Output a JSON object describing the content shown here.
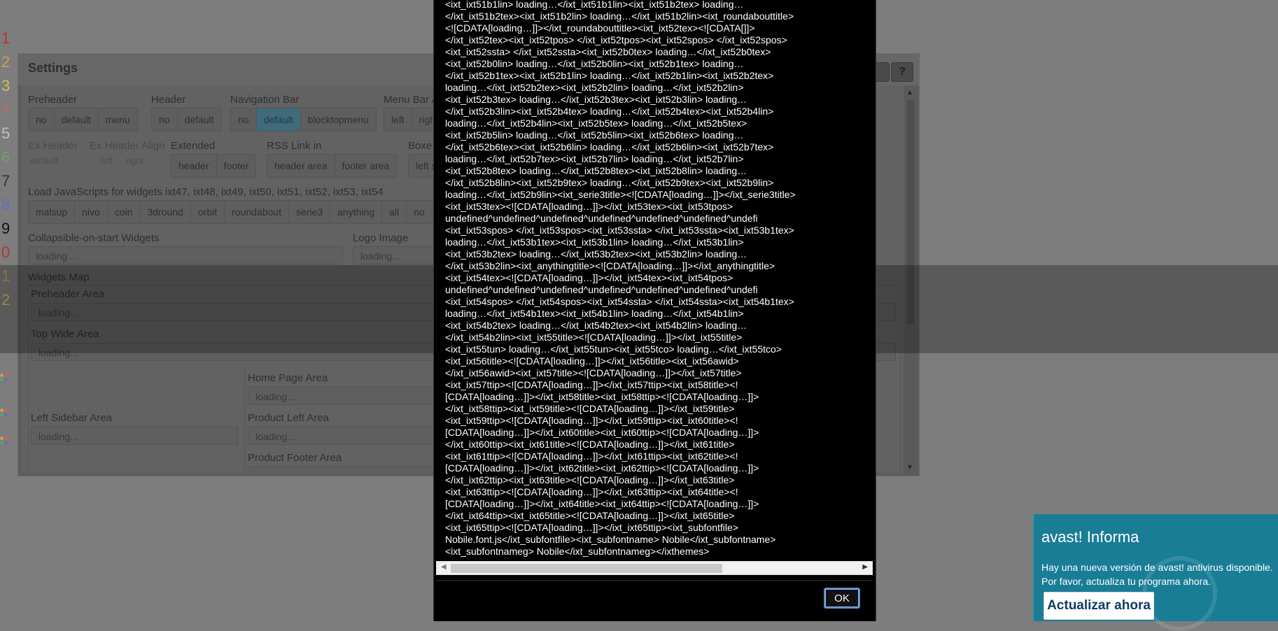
{
  "line_numbers": [
    "1",
    "2",
    "3",
    "4",
    "5",
    "6",
    "7",
    "8",
    "9",
    "0",
    "1",
    "2"
  ],
  "settings": {
    "title": "Settings",
    "help_label": "?",
    "preheader": {
      "label": "Preheader",
      "options": [
        "no",
        "default",
        "menu"
      ]
    },
    "header": {
      "label": "Header",
      "options": [
        "no",
        "default"
      ]
    },
    "navigation_bar": {
      "label": "Navigation Bar",
      "options": [
        "no",
        "default",
        "blocktopmenu"
      ],
      "selected": "default"
    },
    "menu_bar": {
      "label": "Menu Bar A",
      "options": [
        "left",
        "righ"
      ]
    },
    "ex_header": {
      "label": "Ex.Header",
      "value": "default"
    },
    "ex_header_align": {
      "label": "Ex.Header Align",
      "options": [
        "left",
        "right"
      ]
    },
    "extended": {
      "label": "Extended",
      "options": [
        "header",
        "footer"
      ]
    },
    "rss_link": {
      "label": "RSS Link in",
      "options": [
        "header area",
        "footer area"
      ]
    },
    "boxed": {
      "label": "Boxe",
      "options": [
        "left s"
      ]
    },
    "load_js": {
      "label": "Load JavaScripts for widgets ixt47, ixt48, ixt49, ixt50, ixt51, ixt52, ixt53, ixt54",
      "options": [
        "malsup",
        "nivo",
        "coin",
        "3dround",
        "orbit",
        "roundabout",
        "serie3",
        "anything",
        "all",
        "no"
      ]
    },
    "collapsible": {
      "label": "Collapsible-on-start Widgets",
      "value": "loading..."
    },
    "logo_image": {
      "label": "Logo Image",
      "value": "loading..."
    },
    "widgets_map": {
      "label": "Widgets Map",
      "preheader_area": {
        "label": "Preheader Area",
        "value": "loading..."
      },
      "top_wide_area": {
        "label": "Top Wide Area",
        "value": "loading..."
      },
      "left_sidebar_area": {
        "label": "Left Sidebar Area",
        "value": "loading..."
      },
      "home_page_area": {
        "label": "Home Page Area",
        "value": "loading..."
      },
      "product_left_area": {
        "label": "Product Left Area",
        "value": "loading..."
      },
      "product_footer_area": {
        "label": "Product Footer Area",
        "value": "loading..."
      }
    }
  },
  "dialog": {
    "code_lines": [
      "<ixt_ixt51b1lin> loading…</ixt_ixt51b1lin><ixt_ixt51b2tex> loading…",
      "</ixt_ixt51b2tex><ixt_ixt51b2lin> loading…</ixt_ixt51b2lin><ixt_roundabouttitle>",
      "<![CDATA[loading…]]></ixt_roundabouttitle><ixt_ixt52tex><![CDATA[]]>",
      "</ixt_ixt52tex><ixt_ixt52tpos> </ixt_ixt52tpos><ixt_ixt52spos> </ixt_ixt52spos>",
      "<ixt_ixt52ssta> </ixt_ixt52ssta><ixt_ixt52b0tex> loading…</ixt_ixt52b0tex>",
      "<ixt_ixt52b0lin> loading…</ixt_ixt52b0lin><ixt_ixt52b1tex> loading…",
      "</ixt_ixt52b1tex><ixt_ixt52b1lin> loading…</ixt_ixt52b1lin><ixt_ixt52b2tex>",
      "loading…</ixt_ixt52b2tex><ixt_ixt52b2lin> loading…</ixt_ixt52b2lin>",
      "<ixt_ixt52b3tex> loading…</ixt_ixt52b3tex><ixt_ixt52b3lin> loading…",
      "</ixt_ixt52b3lin><ixt_ixt52b4tex> loading…</ixt_ixt52b4tex><ixt_ixt52b4lin>",
      "loading…</ixt_ixt52b4lin><ixt_ixt52b5tex> loading…</ixt_ixt52b5tex>",
      "<ixt_ixt52b5lin> loading…</ixt_ixt52b5lin><ixt_ixt52b6tex> loading…",
      "</ixt_ixt52b6tex><ixt_ixt52b6lin> loading…</ixt_ixt52b6lin><ixt_ixt52b7tex>",
      "loading…</ixt_ixt52b7tex><ixt_ixt52b7lin> loading…</ixt_ixt52b7lin>",
      "<ixt_ixt52b8tex> loading…</ixt_ixt52b8tex><ixt_ixt52b8lin> loading…",
      "</ixt_ixt52b8lin><ixt_ixt52b9tex> loading…</ixt_ixt52b9tex><ixt_ixt52b9lin>",
      "loading…</ixt_ixt52b9lin><ixt_serie3title><![CDATA[loading…]]></ixt_serie3title>",
      "<ixt_ixt53tex><![CDATA[loading…]]></ixt_ixt53tex><ixt_ixt53tpos>",
      "undefined^undefined^undefined^undefined^undefined^undefined^undefi",
      "<ixt_ixt53spos> </ixt_ixt53spos><ixt_ixt53ssta> </ixt_ixt53ssta><ixt_ixt53b1tex>",
      "loading…</ixt_ixt53b1tex><ixt_ixt53b1lin> loading…</ixt_ixt53b1lin>",
      "<ixt_ixt53b2tex> loading…</ixt_ixt53b2tex><ixt_ixt53b2lin> loading…",
      "</ixt_ixt53b2lin><ixt_anythingtitle><![CDATA[loading…]]></ixt_anythingtitle>",
      "<ixt_ixt54tex><![CDATA[loading…]]></ixt_ixt54tex><ixt_ixt54tpos>",
      "undefined^undefined^undefined^undefined^undefined^undefined^undefi",
      "<ixt_ixt54spos> </ixt_ixt54spos><ixt_ixt54ssta> </ixt_ixt54ssta><ixt_ixt54b1tex>",
      "loading…</ixt_ixt54b1tex><ixt_ixt54b1lin> loading…</ixt_ixt54b1lin>",
      "<ixt_ixt54b2tex> loading…</ixt_ixt54b2tex><ixt_ixt54b2lin> loading…",
      "</ixt_ixt54b2lin><ixt_ixt55title><![CDATA[loading…]]></ixt_ixt55title>",
      "<ixt_ixt55tun> loading…</ixt_ixt55tun><ixt_ixt55tco> loading…</ixt_ixt55tco>",
      "<ixt_ixt56title><![CDATA[loading…]]></ixt_ixt56title><ixt_ixt56awid>",
      "</ixt_ixt56awid><ixt_ixt57title><![CDATA[loading…]]></ixt_ixt57title>",
      "<ixt_ixt57ttip><![CDATA[loading…]]></ixt_ixt57ttip><ixt_ixt58title><!",
      "[CDATA[loading…]]></ixt_ixt58title><ixt_ixt58ttip><![CDATA[loading…]]>",
      "</ixt_ixt58ttip><ixt_ixt59title><![CDATA[loading…]]></ixt_ixt59title>",
      "<ixt_ixt59ttip><![CDATA[loading…]]></ixt_ixt59ttip><ixt_ixt60title><!",
      "[CDATA[loading…]]></ixt_ixt60title><ixt_ixt60ttip><![CDATA[loading…]]>",
      "</ixt_ixt60ttip><ixt_ixt61title><![CDATA[loading…]]></ixt_ixt61title>",
      "<ixt_ixt61ttip><![CDATA[loading…]]></ixt_ixt61ttip><ixt_ixt62title><!",
      "[CDATA[loading…]]></ixt_ixt62title><ixt_ixt62ttip><![CDATA[loading…]]>",
      "</ixt_ixt62ttip><ixt_ixt63title><![CDATA[loading…]]></ixt_ixt63title>",
      "<ixt_ixt63ttip><![CDATA[loading…]]></ixt_ixt63ttip><ixt_ixt64title><!",
      "[CDATA[loading…]]></ixt_ixt64title><ixt_ixt64ttip><![CDATA[loading…]]>",
      "</ixt_ixt64ttip><ixt_ixt65title><![CDATA[loading…]]></ixt_ixt65title>",
      "<ixt_ixt65ttip><![CDATA[loading…]]></ixt_ixt65ttip><ixt_subfontfile>",
      "Nobile.font.js</ixt_subfontfile><ixt_subfontname> Nobile</ixt_subfontname>",
      "<ixt_subfontnameg> Nobile</ixt_subfontnameg></ixthemes>"
    ],
    "ok_label": "OK"
  },
  "avast": {
    "title": "avast! Informa",
    "message": "Hay una nueva versión de avast! antivirus disponible. Por favor, actualiza tu programa ahora.",
    "button_label": "Actualizar ahora"
  },
  "colors": {
    "line_number_colors": [
      "#b33",
      "#c8a050",
      "#d0c060",
      "#b07070",
      "#c0c0c0",
      "#70a070",
      "#333",
      "#6070c0",
      "#111",
      "#b33",
      "#c8a050",
      "#d0c060"
    ],
    "accent_selected": "#3f6b7d",
    "avast_bg": "#1a7d96",
    "ok_border": "#5a8bd0"
  }
}
